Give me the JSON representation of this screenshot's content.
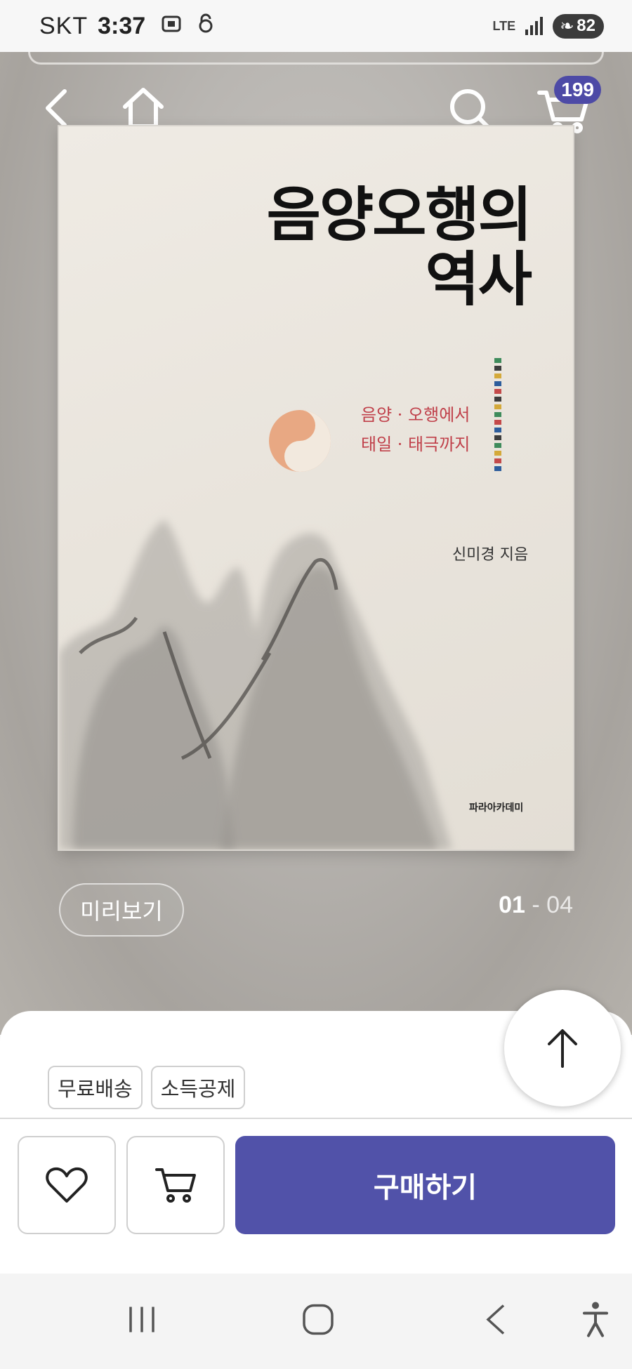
{
  "status_bar": {
    "carrier": "SKT",
    "time": "3:37",
    "network": "LTE",
    "battery": "82"
  },
  "header": {
    "cart_count": "199"
  },
  "book": {
    "title_line1": "음양오행의",
    "title_line2": "역사",
    "subtitle_line1": "음양 · 오행에서",
    "subtitle_line2": "태일 · 태극까지",
    "author": "신미경 지음",
    "publisher": "파라아카데미",
    "strip_colors": [
      "#3e8b5b",
      "#3d3d3d",
      "#d4a93a",
      "#2d5d9c",
      "#c44a4a",
      "#3d3d3d",
      "#d4a93a",
      "#3e8b5b",
      "#c44a4a",
      "#2d5d9c",
      "#3d3d3d",
      "#3e8b5b",
      "#d4a93a",
      "#c44a4a",
      "#2d5d9c"
    ]
  },
  "gallery": {
    "preview_label": "미리보기",
    "page_current": "01",
    "page_separator": " - ",
    "page_total": "04"
  },
  "tags": [
    "무료배송",
    "소득공제"
  ],
  "actions": {
    "buy_label": "구매하기"
  },
  "colors": {
    "accent": "#5152a9",
    "badge": "#4d4aa6"
  }
}
